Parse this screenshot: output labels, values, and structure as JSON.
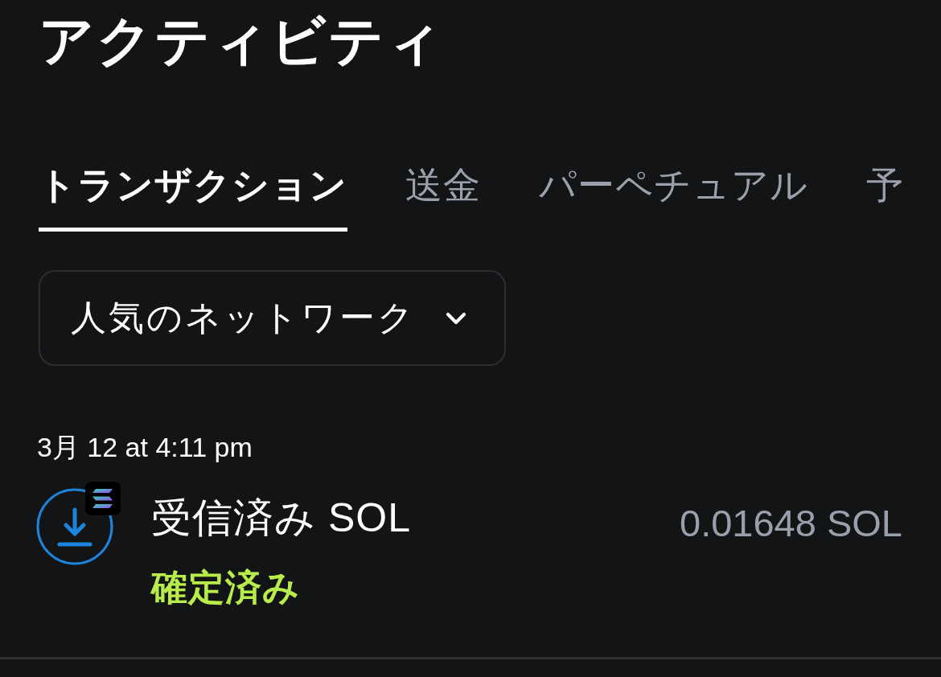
{
  "page": {
    "title": "アクティビティ"
  },
  "tabs": [
    {
      "label": "トランザクション",
      "selected": true
    },
    {
      "label": "送金",
      "selected": false
    },
    {
      "label": "パーペチュアル",
      "selected": false
    },
    {
      "label": "予",
      "selected": false
    }
  ],
  "network_filter": {
    "label": "人気のネットワーク"
  },
  "activity": [
    {
      "date": "3月 12 at 4:11 pm",
      "transactions": [
        {
          "kind": "receive",
          "title": "受信済み SOL",
          "status": "確定済み",
          "amount": "0.01648 SOL"
        }
      ]
    }
  ]
}
